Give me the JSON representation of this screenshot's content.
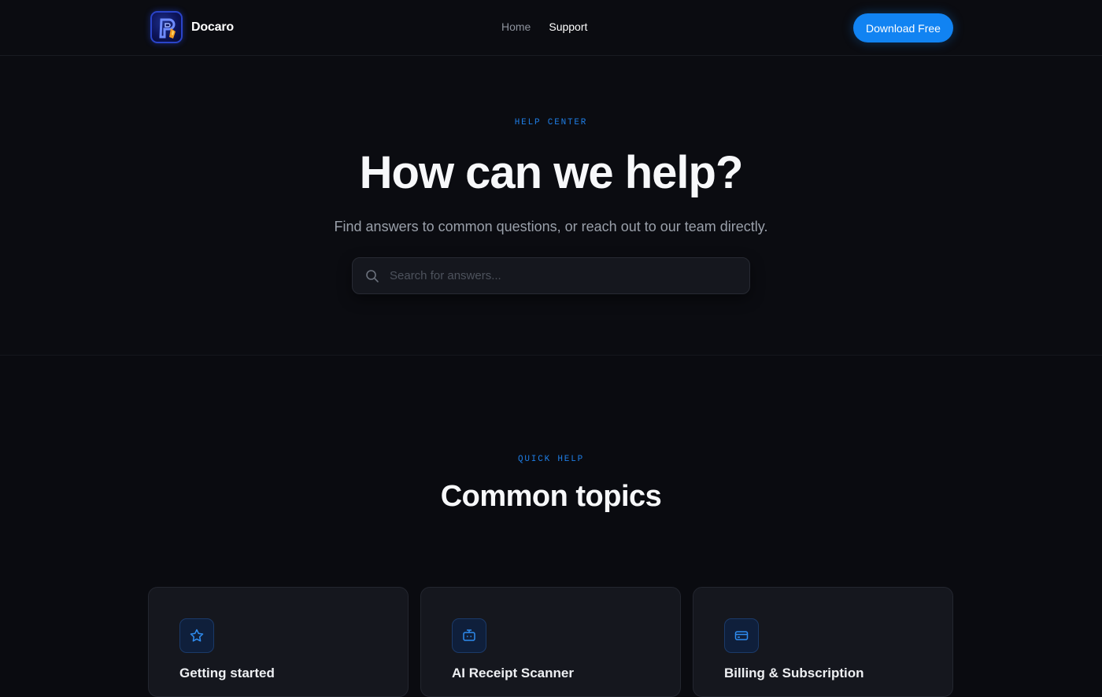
{
  "nav": {
    "brand": "Docaro",
    "links": [
      {
        "label": "Home",
        "active": false
      },
      {
        "label": "Support",
        "active": true
      }
    ],
    "cta_label": "Download Free"
  },
  "hero": {
    "eyebrow": "HELP CENTER",
    "title": "How can we help?",
    "subtitle": "Find answers to common questions, or reach out to our team directly.",
    "search": {
      "placeholder": "Search for answers...",
      "value": "",
      "icon": "search-icon"
    }
  },
  "topics": {
    "eyebrow": "QUICK HELP",
    "title": "Common topics",
    "cards": [
      {
        "title": "Getting started",
        "icon": "star-icon"
      },
      {
        "title": "AI Receipt Scanner",
        "icon": "robot-icon"
      },
      {
        "title": "Billing & Subscription",
        "icon": "credit-card-icon"
      }
    ]
  },
  "colors": {
    "background": "#0a0b10",
    "accent": "#1183f2",
    "eyebrow": "#1f7ee6",
    "card": "#15171e"
  }
}
